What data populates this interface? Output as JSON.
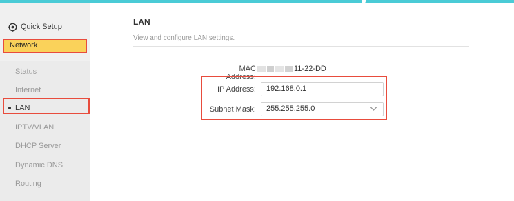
{
  "sidebar": {
    "quick_setup": {
      "label": "Quick Setup",
      "icon": "quick-setup-icon"
    },
    "network": {
      "label": "Network"
    },
    "items": [
      {
        "label": "Status",
        "active": false
      },
      {
        "label": "Internet",
        "active": false
      },
      {
        "label": "LAN",
        "active": true
      },
      {
        "label": "IPTV/VLAN",
        "active": false
      },
      {
        "label": "DHCP Server",
        "active": false
      },
      {
        "label": "Dynamic DNS",
        "active": false
      },
      {
        "label": "Routing",
        "active": false
      }
    ]
  },
  "main": {
    "title": "LAN",
    "subtitle": "View and configure LAN settings.",
    "mac": {
      "label": "MAC Address:",
      "value": "11-22-DD"
    },
    "ip": {
      "label": "IP Address:",
      "value": "192.168.0.1"
    },
    "subnet": {
      "label": "Subnet Mask:",
      "value": "255.255.255.0"
    }
  },
  "colors": {
    "accent_bar": "#4acbd6",
    "highlight": "#fad25a",
    "annotation_border": "#e84c3d"
  }
}
